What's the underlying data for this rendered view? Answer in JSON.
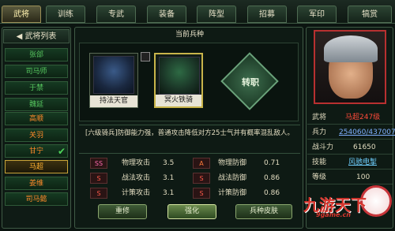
{
  "tabs": [
    "武将",
    "训练",
    "专武",
    "装备",
    "阵型",
    "招募",
    "军印",
    "犒赏"
  ],
  "left": {
    "title": "武将列表",
    "generals": [
      {
        "name": "张郃",
        "color": "green"
      },
      {
        "name": "司马师",
        "color": "green"
      },
      {
        "name": "于禁",
        "color": "green"
      },
      {
        "name": "魏延",
        "color": "green"
      },
      {
        "name": "高顺",
        "color": "orange"
      },
      {
        "name": "关羽",
        "color": "orange"
      },
      {
        "name": "甘宁",
        "color": "orange",
        "checked": true
      },
      {
        "name": "马超",
        "color": "orange",
        "selected": true
      },
      {
        "name": "姜维",
        "color": "orange"
      },
      {
        "name": "司马懿",
        "color": "orange"
      }
    ],
    "check_mark": "✔"
  },
  "main": {
    "current_title": "当前兵种",
    "units": [
      {
        "label": "持法天官"
      },
      {
        "label": "冥火铁骑"
      }
    ],
    "transfer_label": "转职",
    "description": "[六级骑兵]防御能力强，普通攻击降低对方25士气并有概率混乱敌人。",
    "stats": [
      {
        "grade": "SS",
        "name": "物理攻击",
        "value": "3.5",
        "grade2": "A",
        "name2": "物理防御",
        "value2": "0.71"
      },
      {
        "grade": "S",
        "name": "战法攻击",
        "value": "3.1",
        "grade2": "S",
        "name2": "战法防御",
        "value2": "0.86"
      },
      {
        "grade": "S",
        "name": "计策攻击",
        "value": "3.1",
        "grade2": "S",
        "name2": "计策防御",
        "value2": "0.86"
      }
    ],
    "buttons": [
      "重修",
      "强化",
      "兵种皮肤"
    ]
  },
  "right": {
    "info": [
      {
        "key": "武将",
        "value": "马超247级",
        "style": "red"
      },
      {
        "key": "兵力",
        "value": "254060/437007",
        "style": "blue"
      },
      {
        "key": "战斗力",
        "value": "61650",
        "style": "plain"
      },
      {
        "key": "技能",
        "value": "风驰电掣",
        "style": "cyan"
      },
      {
        "key": "等级",
        "value": "100",
        "style": "plain"
      }
    ]
  },
  "watermark": {
    "text": "九游天下",
    "sub": "9game.cn"
  },
  "colors": {
    "accent": "#c8a438",
    "green_name": "#56c65e",
    "orange_name": "#ff8a2a",
    "red_value": "#ff4a3a"
  }
}
